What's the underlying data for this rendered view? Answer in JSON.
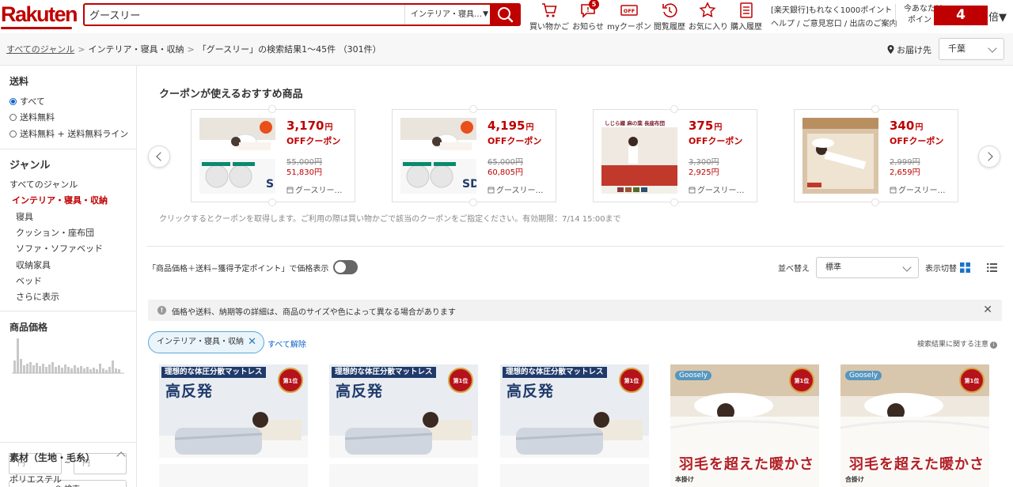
{
  "header": {
    "logo": "Rakuten",
    "search_value": "グースリー",
    "search_genre": "インテリア・寝具…",
    "icons": [
      {
        "name": "cart-icon",
        "label": "買い物かご"
      },
      {
        "name": "notification-icon",
        "label": "お知らせ",
        "badge": "5"
      },
      {
        "name": "coupon-icon",
        "label": "myクーポン",
        "icon_text": "OFF"
      },
      {
        "name": "history-icon",
        "label": "閲覧履歴"
      },
      {
        "name": "favorite-icon",
        "label": "お気に入り"
      },
      {
        "name": "purchase-history-icon",
        "label": "購入履歴"
      }
    ],
    "bank_promo": "[楽天銀行]もれなく1000ポイント",
    "help_links": "ヘルプ / ご意見窓口 / 出店のご案内",
    "points_label_line1": "今あなたは",
    "points_label_line2": "ポイント",
    "points_value": "4",
    "points_unit": "倍▼"
  },
  "breadcrumb": {
    "items": [
      "すべてのジャンル",
      "インテリア・寝具・収納",
      "「グースリー」の検索結果1〜45件 （301件）"
    ],
    "deliver_label": "お届け先",
    "deliver_value": "千葉"
  },
  "sidebar": {
    "shipping_title": "送料",
    "shipping_options": [
      "すべて",
      "送料無料",
      "送料無料 + 送料無料ライン"
    ],
    "genre_title": "ジャンル",
    "genre_all": "すべてのジャンル",
    "genre_active": "インテリア・寝具・収納",
    "genre_items": [
      "寝具",
      "クッション・座布団",
      "ソファ・ソファベッド",
      "収納家具",
      "ベッド",
      "さらに表示"
    ],
    "price_title": "商品価格",
    "price_min_placeholder": "円",
    "price_tilde": "~",
    "price_max_placeholder": "円",
    "price_search": "検索",
    "material_title": "素材（生地・毛糸）",
    "material_first": "ポリエステル"
  },
  "coupons": {
    "title": "クーポンが使えるおすすめ商品",
    "off_label": "OFFクーポン",
    "yen": "円",
    "items": [
      {
        "amount": "3,170",
        "old_price": "55,000円",
        "new_price": "51,830円",
        "shop": "グースリー…",
        "size": "S"
      },
      {
        "amount": "4,195",
        "old_price": "65,000円",
        "new_price": "60,805円",
        "shop": "グースリー…",
        "size": "SD"
      },
      {
        "amount": "375",
        "old_price": "3,300円",
        "new_price": "2,925円",
        "shop": "グースリー…",
        "img_text": "しじら織 麻の葉 長座布団"
      },
      {
        "amount": "340",
        "old_price": "2,999円",
        "new_price": "2,659円",
        "shop": "グースリー…"
      }
    ],
    "note": "クリックするとクーポンを取得します。ご利用の際は買い物かごで該当のクーポンをご指定ください。有効期限：7/14 15:00まで"
  },
  "controls": {
    "toggle_label": "「商品価格＋送料−獲得予定ポイント」で価格表示",
    "sort_label": "並べ替え",
    "sort_value": "標準",
    "view_label": "表示切替"
  },
  "notice": {
    "icon": "!",
    "text": "価格や送料、納期等の詳細は、商品のサイズや色によって異なる場合があります",
    "close": "✕"
  },
  "filters": {
    "chip": "インテリア・寝具・収納",
    "chip_close": "✕",
    "clear_all": "すべて解除",
    "caution": "検索結果に関する注意"
  },
  "products": [
    {
      "banner": "理想的な体圧分散マットレス",
      "headline": "高反発",
      "rank": "第1位"
    },
    {
      "banner": "理想的な体圧分散マットレス",
      "headline": "高反発",
      "rank": "第1位"
    },
    {
      "banner": "理想的な体圧分散マットレス",
      "headline": "高反発",
      "rank": "第1位"
    },
    {
      "brand": "Goosely",
      "headline": "羽毛を超えた暖かさ",
      "rank": "第1位",
      "tag": "本掛け"
    },
    {
      "brand": "Goosely",
      "headline": "羽毛を超えた暖かさ",
      "rank": "第1位",
      "tag": "合掛け"
    }
  ],
  "colors": {
    "brand_red": "#bf0000",
    "link_blue": "#0a63c7"
  }
}
